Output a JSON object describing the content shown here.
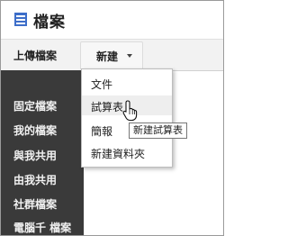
{
  "app": {
    "title": "檔案",
    "icon": "drive-list-icon",
    "icon_color": "#3d6ec9"
  },
  "toolbar": {
    "upload_label": "上傳檔案",
    "new_label": "新建"
  },
  "sidebar": {
    "items": [
      {
        "label": "固定檔案"
      },
      {
        "label": "我的檔案"
      },
      {
        "label": "與我共用"
      },
      {
        "label": "由我共用"
      },
      {
        "label": "社群檔案"
      },
      {
        "label": "電腦千 檔案"
      }
    ]
  },
  "new_menu": {
    "items": [
      {
        "label": "文件"
      },
      {
        "label": "試算表"
      },
      {
        "label": "簡報"
      },
      {
        "label": "新建資料夾"
      }
    ],
    "hovered_index": 1
  },
  "tooltip": {
    "text": "新建試算表"
  },
  "colors": {
    "sidebar_bg": "#3a3a3a",
    "toolbar_bg": "#f2f2f2",
    "accent": "#3d6ec9"
  }
}
